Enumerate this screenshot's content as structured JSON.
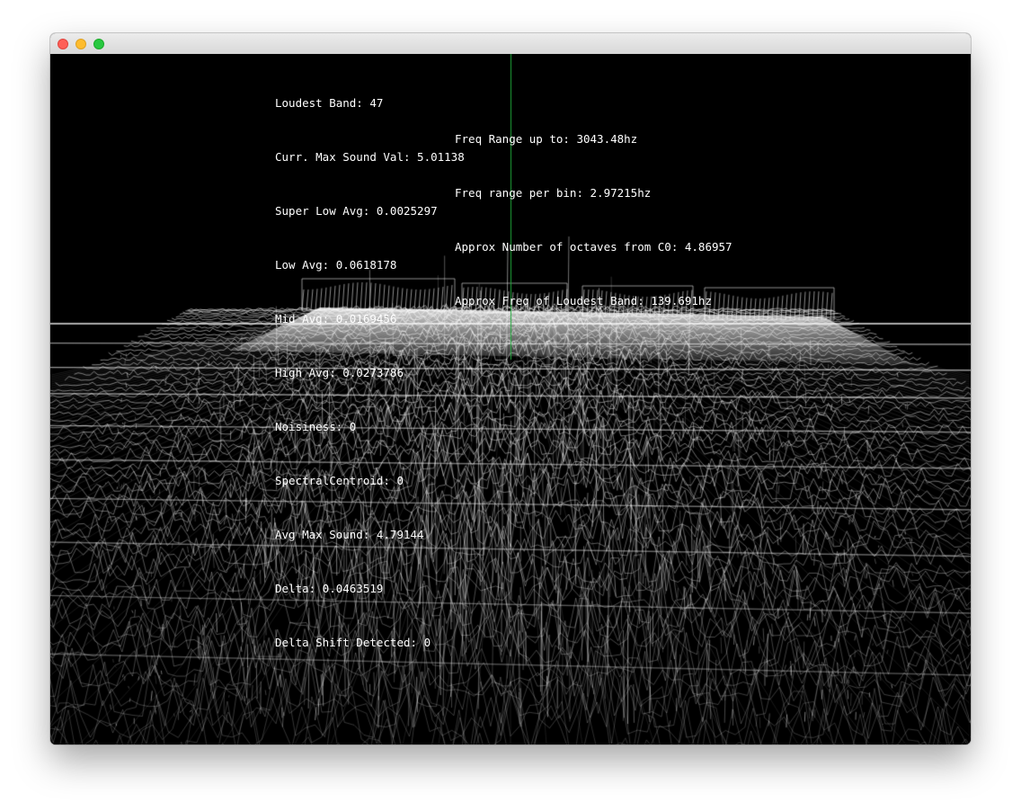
{
  "window": {
    "controls": {
      "close": "close-button",
      "minimize": "minimize-button",
      "maximize": "maximize-button"
    }
  },
  "hud": {
    "left_lines": [
      "Loudest Band: 47",
      "Curr. Max Sound Val: 5.01138",
      "Super Low Avg: 0.0025297",
      "Low Avg: 0.0618178",
      "Mid Avg: 0.0169456",
      "High Avg: 0.0273786",
      "Noisiness: 0",
      "SpectralCentroid: 0",
      "Avg Max Sound: 4.79144",
      "Delta: 0.0463519",
      "Delta Shift Detected: 0"
    ],
    "right_lines": [
      "Freq Range up to: 3043.48hz",
      "Freq range per bin: 2.97215hz",
      "Approx Number of octaves from C0: 4.86957",
      "Approx Freq of Loudest Band: 139.691hz"
    ]
  },
  "visualization": {
    "style": "3d-wireframe-spectrogram",
    "colors": {
      "background": "#000000",
      "mesh": "#ffffff",
      "center_line": "#1fa83a"
    }
  }
}
